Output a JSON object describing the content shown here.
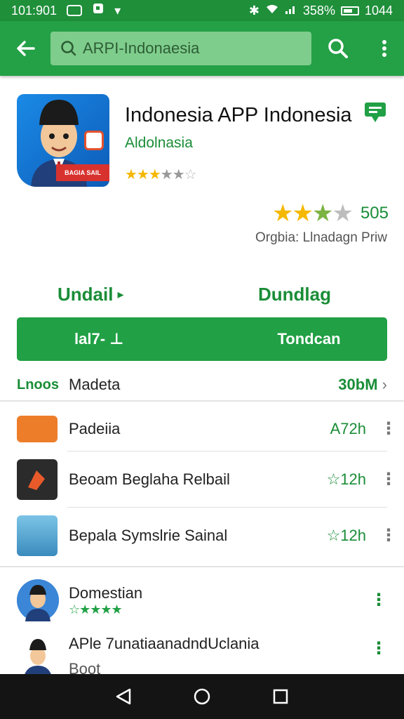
{
  "status_bar": {
    "time_left": "101:901",
    "battery_pct": "358%",
    "time_right": "1044"
  },
  "search": {
    "query": "ARPI-Indonaesia"
  },
  "app": {
    "title": "Indonesia APP Indonesia",
    "developer": "Aldolnasia",
    "stars_small": "★★★★★",
    "rating_stars": "★★★★",
    "rating_value": "505",
    "rating_sub": "Orgbia: Llnadagn Priw",
    "icon_banner_text": "BAGIA SAIL"
  },
  "actions": {
    "link_left": "Undail",
    "link_left_arrow": "▸",
    "link_right": "Dundlag",
    "button_left": "lal7- ⊥",
    "button_right": "Tondcan"
  },
  "section": {
    "tag": "Lnoos",
    "title": "Madeta",
    "more": "30bM",
    "chevron": "›"
  },
  "list": [
    {
      "title": "Padeiia",
      "size": "A72h"
    },
    {
      "title": "Beoam Beglaha Relbail",
      "size": "☆12h"
    },
    {
      "title": "Bepala Symslrie Sainal",
      "size": "☆12h"
    }
  ],
  "people": [
    {
      "name": "Domestian",
      "stars": "☆★★★★"
    },
    {
      "name": "APle 7unatiaanadndUclania",
      "sub": "Boot"
    }
  ],
  "colors": {
    "primary": "#24a046",
    "accent_text": "#1a8d37",
    "status_bar": "#1f8f3a"
  }
}
